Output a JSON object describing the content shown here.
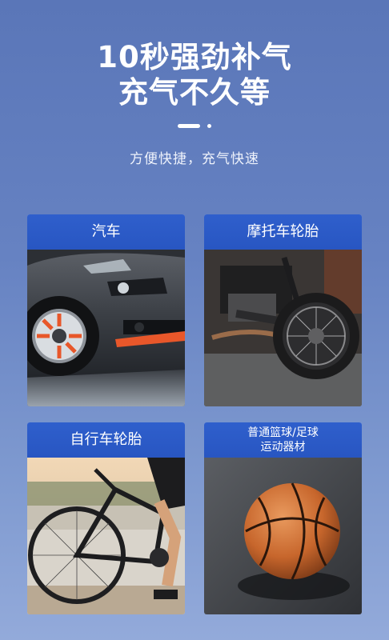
{
  "hero": {
    "title_line1": "10秒强劲补气",
    "title_line2": "充气不久等",
    "subtitle": "方便快捷，充气快速"
  },
  "cards": [
    {
      "id": "car",
      "label": "汽车",
      "image": "car-wheel-photo"
    },
    {
      "id": "moto",
      "label": "摩托车轮胎",
      "image": "motorcycle-tire-photo"
    },
    {
      "id": "bike",
      "label": "自行车轮胎",
      "image": "bicycle-photo"
    },
    {
      "id": "ball",
      "label_line1": "普通篮球/足球",
      "label_line2": "运动器材",
      "image": "basketball-photo"
    }
  ],
  "colors": {
    "background_top": "#5a76b8",
    "background_bottom": "#93aada",
    "card_header": "#2f5fcc",
    "accent_orange": "#e8572a"
  }
}
